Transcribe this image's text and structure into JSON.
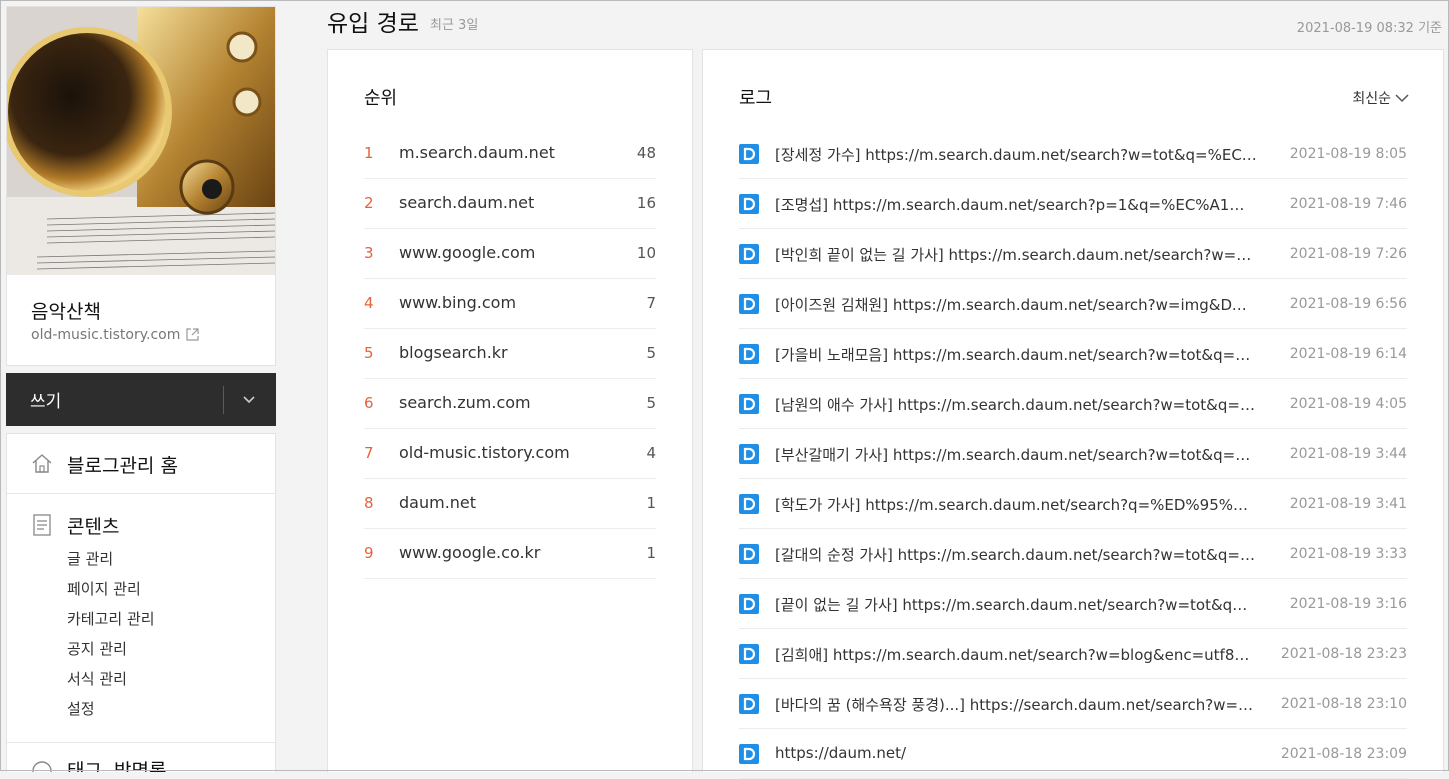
{
  "sidebar": {
    "blog_name": "음악산책",
    "blog_url": "old-music.tistory.com",
    "write_label": "쓰기",
    "home_label": "블로그관리 홈",
    "content_label": "콘텐츠",
    "content_items": [
      "글 관리",
      "페이지 관리",
      "카테고리 관리",
      "공지 관리",
      "서식 관리",
      "설정"
    ],
    "next_section_label": "태그, 방명록"
  },
  "header": {
    "title": "유입 경로",
    "subtitle": "최근 3일",
    "timestamp": "2021-08-19 08:32 기준"
  },
  "ranking": {
    "title": "순위",
    "rows": [
      {
        "rank": "1",
        "domain": "m.search.daum.net",
        "count": "48"
      },
      {
        "rank": "2",
        "domain": "search.daum.net",
        "count": "16"
      },
      {
        "rank": "3",
        "domain": "www.google.com",
        "count": "10"
      },
      {
        "rank": "4",
        "domain": "www.bing.com",
        "count": "7"
      },
      {
        "rank": "5",
        "domain": "blogsearch.kr",
        "count": "5"
      },
      {
        "rank": "6",
        "domain": "search.zum.com",
        "count": "5"
      },
      {
        "rank": "7",
        "domain": "old-music.tistory.com",
        "count": "4"
      },
      {
        "rank": "8",
        "domain": "daum.net",
        "count": "1"
      },
      {
        "rank": "9",
        "domain": "www.google.co.kr",
        "count": "1"
      }
    ]
  },
  "log": {
    "title": "로그",
    "sort_label": "최신순",
    "rows": [
      {
        "text": "[장세정 가수] https://m.search.daum.net/search?w=tot&q=%EC…",
        "time": "2021-08-19 8:05"
      },
      {
        "text": "[조명섭] https://m.search.daum.net/search?p=1&q=%EC%A1%B…",
        "time": "2021-08-19 7:46"
      },
      {
        "text": "[박인희 끝이 없는 길 가사] https://m.search.daum.net/search?w=t…",
        "time": "2021-08-19 7:26"
      },
      {
        "text": "[아이즈원 김채원] https://m.search.daum.net/search?w=img&DA…",
        "time": "2021-08-19 6:56"
      },
      {
        "text": "[가을비 노래모음] https://m.search.daum.net/search?w=tot&q=%…",
        "time": "2021-08-19 6:14"
      },
      {
        "text": "[남원의 애수 가사] https://m.search.daum.net/search?w=tot&q=…",
        "time": "2021-08-19 4:05"
      },
      {
        "text": "[부산갈매기 가사] https://m.search.daum.net/search?w=tot&q=%…",
        "time": "2021-08-19 3:44"
      },
      {
        "text": "[학도가 가사] https://m.search.daum.net/search?q=%ED%95%99…",
        "time": "2021-08-19 3:41"
      },
      {
        "text": "[갈대의 순정 가사] https://m.search.daum.net/search?w=tot&q=…",
        "time": "2021-08-19 3:33"
      },
      {
        "text": "[끝이 없는 길 가사] https://m.search.daum.net/search?w=tot&q=…",
        "time": "2021-08-19 3:16"
      },
      {
        "text": "[김희애] https://m.search.daum.net/search?w=blog&enc=utf8&…",
        "time": "2021-08-18 23:23"
      },
      {
        "text": "[바다의 꿈 (해수욕장 풍경)...] https://search.daum.net/search?w=t…",
        "time": "2021-08-18 23:10"
      },
      {
        "text": "https://daum.net/",
        "time": "2021-08-18 23:09"
      }
    ]
  },
  "colors": {
    "rank_number": "#e5623f",
    "source_icon": "#1f8ee6",
    "write_bar": "#2d2d2d"
  }
}
